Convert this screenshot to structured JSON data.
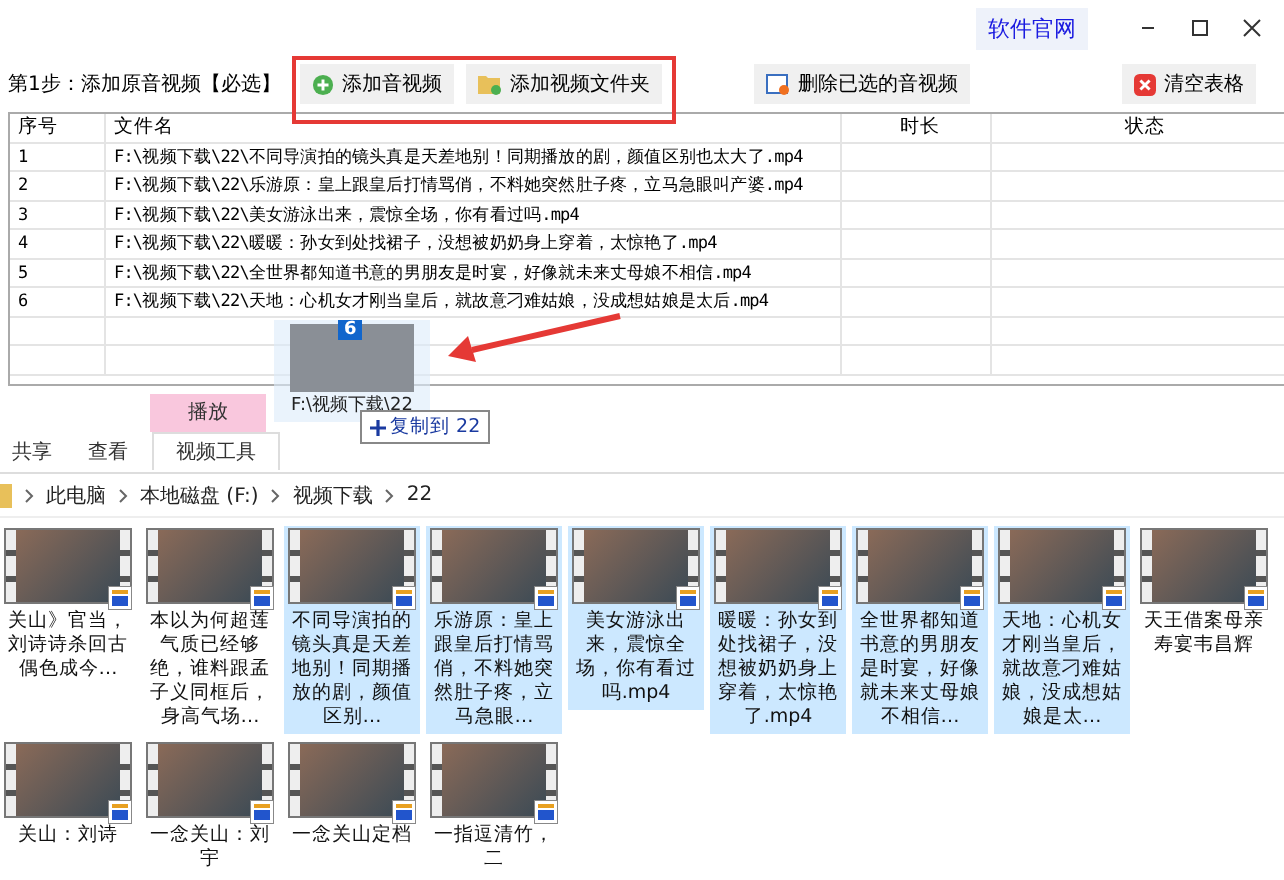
{
  "window": {
    "link": "软件官网"
  },
  "toolbar": {
    "step_label": "第1步：添加原音视频【必选】",
    "buttons": [
      {
        "label": "添加音视频"
      },
      {
        "label": "添加视频文件夹"
      },
      {
        "label": "删除已选的音视频"
      },
      {
        "label": "清空表格"
      }
    ]
  },
  "table": {
    "columns": [
      "序号",
      "文件名",
      "时长",
      "状态"
    ],
    "rows": [
      {
        "index": "1",
        "file": "F:\\视频下载\\22\\不同导演拍的镜头真是天差地别！同期播放的剧，颜值区别也太大了.mp4"
      },
      {
        "index": "2",
        "file": "F:\\视频下载\\22\\乐游原：皇上跟皇后打情骂俏，不料她突然肚子疼，立马急眼叫产婆.mp4"
      },
      {
        "index": "3",
        "file": "F:\\视频下载\\22\\美女游泳出来，震惊全场，你有看过吗.mp4"
      },
      {
        "index": "4",
        "file": "F:\\视频下载\\22\\暖暖：孙女到处找裙子，没想被奶奶身上穿着，太惊艳了.mp4"
      },
      {
        "index": "5",
        "file": "F:\\视频下载\\22\\全世界都知道书意的男朋友是时宴，好像就未来丈母娘不相信.mp4"
      },
      {
        "index": "6",
        "file": "F:\\视频下载\\22\\天地：心机女才刚当皇后，就故意刁难姑娘，没成想姑娘是太后.mp4"
      }
    ]
  },
  "drag": {
    "count": "6",
    "label": "F:\\视频下载\\22",
    "tooltip": "复制到 22"
  },
  "ribbon": {
    "context_tab": "播放",
    "tabs": [
      {
        "label": "共享",
        "selected": false
      },
      {
        "label": "查看",
        "selected": false
      },
      {
        "label": "视频工具",
        "selected": true
      }
    ]
  },
  "breadcrumb": [
    "此电脑",
    "本地磁盘 (F:)",
    "视频下载",
    "22"
  ],
  "files": [
    [
      {
        "caption": "关山》官当，刘诗诗杀回古偶色成今…",
        "selected": false
      },
      {
        "caption": "本以为何超莲气质已经够绝，谁料跟孟子义同框后，身高气场…",
        "selected": false
      },
      {
        "caption": "不同导演拍的镜头真是天差地别！同期播放的剧，颜值区别…",
        "selected": true
      },
      {
        "caption": "乐游原：皇上跟皇后打情骂俏，不料她突然肚子疼，立马急眼…",
        "selected": true
      },
      {
        "caption": "美女游泳出来，震惊全场，你有看过吗.mp4",
        "selected": true
      },
      {
        "caption": "暖暖：孙女到处找裙子，没想被奶奶身上穿着，太惊艳了.mp4",
        "selected": true
      },
      {
        "caption": "全世界都知道书意的男朋友是时宴，好像就未来丈母娘不相信…",
        "selected": true
      },
      {
        "caption": "天地：心机女才刚当皇后，就故意刁难姑娘，没成想姑娘是太…",
        "selected": true
      },
      {
        "caption": "天王借案母亲寿宴韦昌辉",
        "selected": false
      }
    ],
    [
      {
        "caption": "关山：刘诗",
        "selected": false
      },
      {
        "caption": "一念关山：刘宇",
        "selected": false
      },
      {
        "caption": "一念关山定档",
        "selected": false
      },
      {
        "caption": "一指逗清竹，二",
        "selected": false
      }
    ]
  ]
}
